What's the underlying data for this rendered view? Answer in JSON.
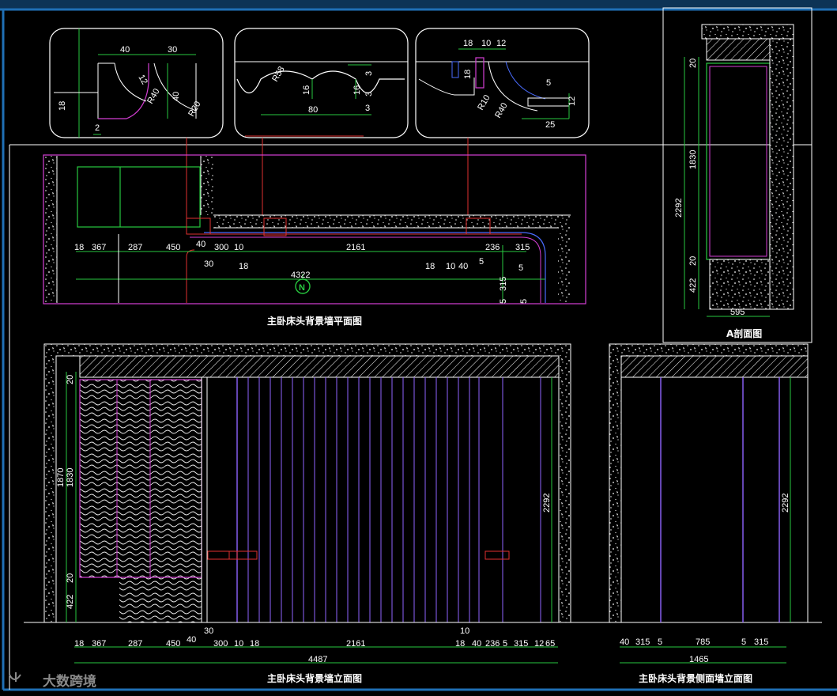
{
  "colors": {
    "background": "#000000",
    "frame": "#1f6fb5",
    "outline": "#ffffff",
    "dimension": "#27c93f",
    "magenta": "#d43fd4",
    "red": "#e0302f",
    "violet": "#8f63ff",
    "blue": "#4a6cff"
  },
  "watermark": {
    "brand": "大数跨境"
  },
  "details": {
    "d1": [
      "40",
      "30",
      "12",
      "R40",
      "40",
      "R20",
      "18",
      "2"
    ],
    "d2": [
      "R58",
      "3",
      "16",
      "16",
      "80",
      "3",
      "3"
    ],
    "d3": [
      "18",
      "10",
      "12",
      "18",
      "R10",
      "R40",
      "5",
      "12",
      "25"
    ]
  },
  "plan": {
    "title": "主卧床头背景墙平面图",
    "row1": [
      "18",
      "367",
      "287",
      "450",
      "40",
      "300",
      "10",
      "2161",
      "236",
      "315"
    ],
    "row2": [
      "30",
      "18",
      "18",
      "10",
      "40",
      "5",
      "5"
    ],
    "total": "4322",
    "right": [
      "315",
      "5",
      "5"
    ],
    "north": "N"
  },
  "section": {
    "title": "A剖面图",
    "height": "2292",
    "vert": [
      "20",
      "1830",
      "20",
      "422"
    ],
    "width": "595"
  },
  "elevation": {
    "title": "主卧床头背景墙立面图",
    "left": [
      "20",
      "1870",
      "1830",
      "20",
      "422"
    ],
    "height": "2292",
    "bottom": [
      "18",
      "367",
      "287",
      "450",
      "40",
      "30",
      "300",
      "10",
      "18",
      "2161",
      "10",
      "18",
      "40",
      "236",
      "5",
      "315",
      "12",
      "65"
    ],
    "total": "4487"
  },
  "side": {
    "title": "主卧床头背景侧面墙立面图",
    "height": "2292",
    "bottom": [
      "40",
      "315",
      "5",
      "785",
      "5",
      "315"
    ],
    "total": "1465"
  }
}
